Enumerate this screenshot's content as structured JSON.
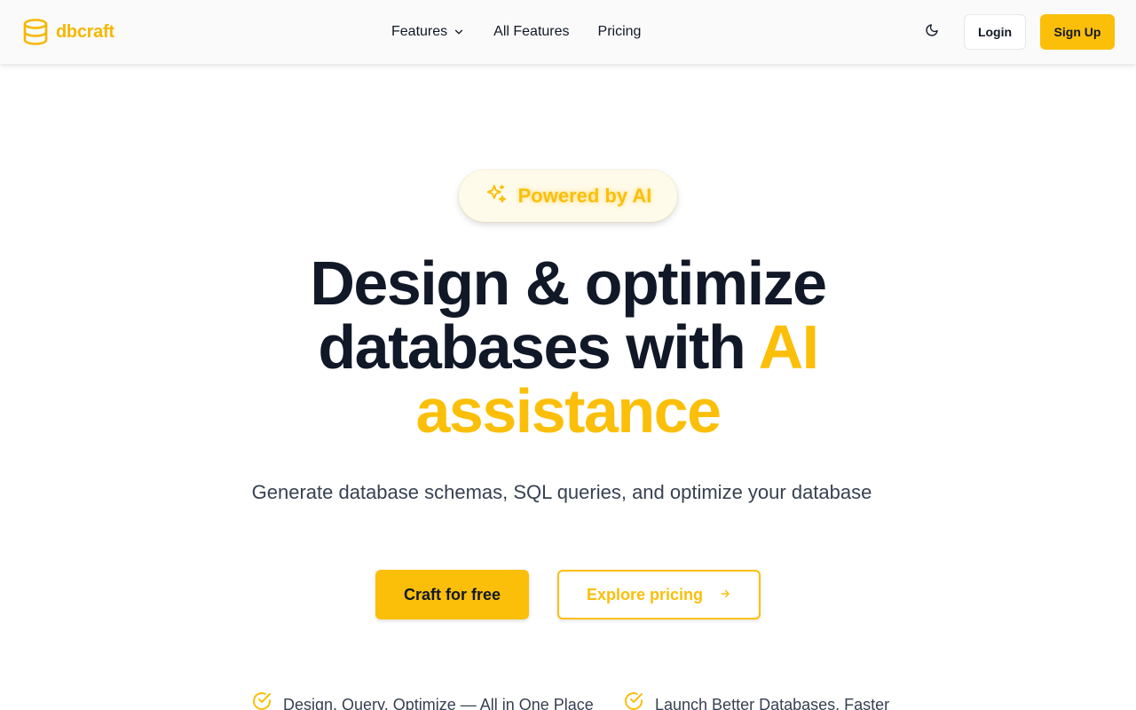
{
  "brand": {
    "name": "dbcraft",
    "color": "#f5b700"
  },
  "nav": {
    "items": [
      {
        "label": "Features",
        "has_dropdown": true
      },
      {
        "label": "All Features"
      },
      {
        "label": "Pricing"
      }
    ]
  },
  "header": {
    "theme_icon": "moon-icon",
    "login_label": "Login",
    "signup_label": "Sign Up"
  },
  "badge": {
    "icon": "sparkles-icon",
    "label": "Powered by AI"
  },
  "hero": {
    "title_line1": "Design & optimize",
    "title_line2_a": "databases with ",
    "title_line2_b": "AI",
    "title_line3": "assistance",
    "subtitle": "Generate database schemas, SQL queries, and optimize your database"
  },
  "cta": {
    "primary_label": "Craft for free",
    "secondary_label": "Explore pricing",
    "secondary_icon": "arrow-right-icon"
  },
  "features": [
    {
      "icon": "check-circle-icon",
      "label": "Design, Query, Optimize — All in One Place"
    },
    {
      "icon": "check-circle-icon",
      "label": "Launch Better Databases, Faster"
    }
  ],
  "colors": {
    "accent": "#fbbf0a",
    "text": "#111827",
    "muted": "#374151"
  }
}
